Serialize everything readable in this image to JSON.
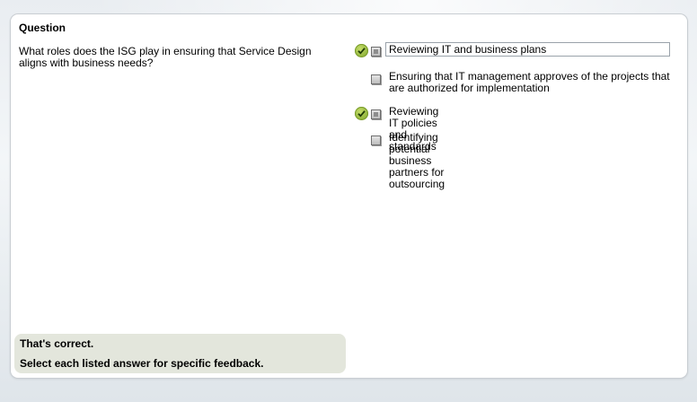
{
  "question": {
    "heading": "Question",
    "text": "What roles does the ISG play in ensuring that Service Design aligns with business needs?"
  },
  "answers": [
    {
      "label": "Reviewing IT and business plans",
      "checked": true,
      "correct_marker": true
    },
    {
      "label": "Ensuring that IT management approves of the projects that are authorized for implementation",
      "checked": false,
      "correct_marker": false
    },
    {
      "label": "Reviewing IT policies and standards",
      "checked": true,
      "correct_marker": true
    },
    {
      "label": "Identifying potential business partners for outsourcing",
      "checked": false,
      "correct_marker": false
    }
  ],
  "feedback": {
    "status": "That's correct.",
    "instruction": "Select each listed answer for specific feedback."
  },
  "colors": {
    "correct_marker": "#8fb33a",
    "feedback_bg": "#e3e6dc"
  }
}
